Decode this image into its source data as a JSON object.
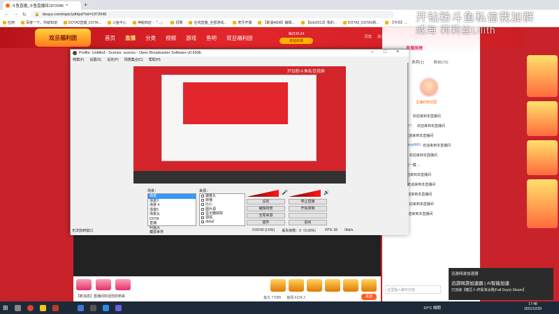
{
  "browser": {
    "tab_title": "斗鱼直播_斗鱼直播间1972046",
    "url": "douyu.com/topic/ydhlpd?rid=1972046",
    "bookmarks": [
      "应用",
      "百度一下，你就知道",
      "DOTA2直播_DOTA...",
      "斗鱼中心",
      "神秘商店 - 「...」",
      "招聘",
      "在线直播_全部游戏...",
      "虎牙开播",
      "【斯温4808】编辑...",
      "【Edo2513】我的...",
      "DOTA2_DOTA2新...",
      "【今日】..."
    ]
  },
  "site": {
    "logo_text": "双旦福利团",
    "nav": [
      "首页",
      "直播",
      "分类",
      "视频",
      "游戏",
      "鱼吧",
      "双旦福利团"
    ],
    "active_nav": "直播",
    "promo_line1": "每日20:24",
    "promo_btn": "去钻石领",
    "top_icons": [
      "历史",
      "关注",
      "开播",
      "下载",
      "消息",
      "创作中心"
    ]
  },
  "watermark": {
    "line1": "开钻粉斗鱼私信我加群",
    "line2": "威海  莉莉丝Lilith"
  },
  "obs": {
    "title": "Profile: Untitled - Scenes: scenes - Open Broadcaster Software v0.659b",
    "menu": [
      "档案(F)",
      "设置(S)",
      "设定(P)",
      "场景集合(C)",
      "帮助(H)"
    ],
    "preview_watermark": "开钻粉斗鱼私信我群",
    "scenes_label": "场景：",
    "scenes": [
      "场景",
      "场景3",
      "场景 4",
      "场景5",
      "场景头",
      "DOTA",
      "直播",
      "叫我大",
      "藏源世界"
    ],
    "sources_label": "来源：",
    "sources": [
      "摄像头",
      "转播",
      "比心",
      "图片源",
      "显示器获取",
      "源情",
      "dota2"
    ],
    "buttons": [
      "设定",
      "停止直播",
      "编辑场景",
      "开始录制",
      "全局来源",
      "",
      "插件",
      "退出"
    ],
    "status_left": "无法找到窗口",
    "status_time": "0:00:00 (LIVE)",
    "status_drop": "丢失帧数：0（0.00%）",
    "status_fps": "FPS: 60",
    "status_kbps": "0kb/s"
  },
  "room": {
    "right_tabs": [
      "贡献周榜",
      "贵宾(1)",
      "粉丝(72)"
    ],
    "anchor_name": "主播的粉丝团",
    "rank_text": "直播周榜",
    "chat": [
      {
        "user": "斯温飞飞：",
        "text": "欢迎来到本直播间"
      },
      {
        "user": "一开光1777：",
        "text": "欢迎来到本直播间"
      },
      {
        "user": "Sen ↗",
        "text": "欢迎来到本直播间"
      },
      {
        "user": "ShawnWang4869",
        "text": "欢迎来到本直播间"
      },
      {
        "user": "hedesplc",
        "text": "欢迎来到本直播间"
      },
      {
        "user": "",
        "text": "连续点击一键 ..."
      },
      {
        "user": "hugh",
        "text": "欢迎来到本直播间"
      },
      {
        "user": "wh7080",
        "text": "欢迎来到本直播间"
      },
      {
        "user": "ssmill",
        "text": "欢迎来到本直播间"
      },
      {
        "user": "夏小沫",
        "text": "欢迎来到本直播间"
      },
      {
        "user": "Locoo",
        "text": "欢迎来到本直播间"
      }
    ],
    "chat_placeholder": "这里输入聊天内容",
    "bottom_text": "【新消息】直播间欢迎您的到来",
    "stats": [
      "鱼丸 77085",
      "鱼翅 6234.2"
    ],
    "send_label": "发送"
  },
  "notification": {
    "app": "迅游网游加速器",
    "headline": "迅游网游加速器 | AI智能加速",
    "body": "已加速【糖豆人:终极淘汰赛(Fall Guys)-Steam】"
  },
  "taskbar": {
    "weather": "10°C 晴朗",
    "time": "17:48",
    "date": "2021/12/29"
  },
  "colors": {
    "douyu_red": "#c8232a",
    "accent_orange": "#ff6a00"
  }
}
